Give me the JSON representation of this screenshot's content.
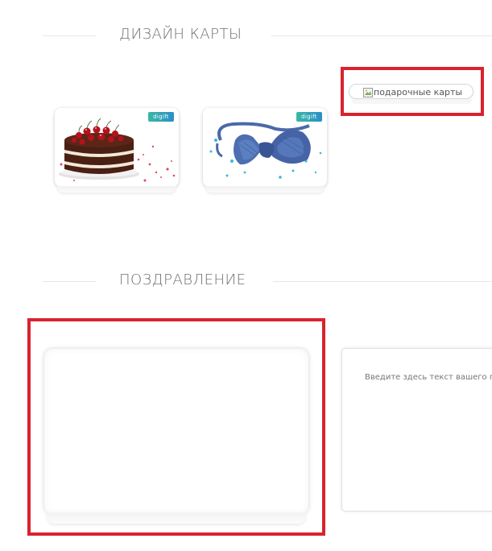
{
  "sections": {
    "design_title": "ДИЗАЙН КАРТЫ",
    "greeting_title": "ПОЗДРАВЛЕНИЕ"
  },
  "cards": [
    {
      "name": "cake",
      "logo": "digift",
      "image": "cake-icon"
    },
    {
      "name": "bow-tie",
      "logo": "digift",
      "image": "bow-tie-icon"
    }
  ],
  "broken_image": {
    "alt": "подарочные карты"
  },
  "message": {
    "placeholder": "Введите здесь текст вашего поздравления"
  },
  "colors": {
    "highlight": "#d9232d",
    "logo_start": "#39b7a6",
    "logo_end": "#2a8fc8",
    "title": "#6f6f6f"
  }
}
